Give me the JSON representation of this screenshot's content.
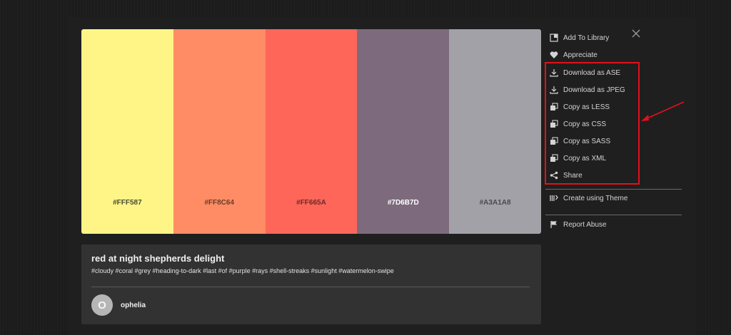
{
  "palette": {
    "swatches": [
      {
        "hex": "#FFF587",
        "label": "#FFF587",
        "text_color": "#4a4a30"
      },
      {
        "hex": "#FF8C64",
        "label": "#FF8C64",
        "text_color": "#6b3c2a"
      },
      {
        "hex": "#FF665A",
        "label": "#FF665A",
        "text_color": "#6d2a25"
      },
      {
        "hex": "#7D6B7D",
        "label": "#7D6B7D",
        "text_color": "#ffffff"
      },
      {
        "hex": "#A3A1A8",
        "label": "#A3A1A8",
        "text_color": "#4a4a4e"
      }
    ]
  },
  "theme": {
    "title": "red at night shepherds delight",
    "tags": "#cloudy #coral #grey #heading-to-dark #last #of #purple #rays #shell-streaks #sunlight #watermelon-swipe",
    "author_initial": "O",
    "author": "ophelia"
  },
  "sidebar": {
    "add_to_library": "Add To Library",
    "appreciate": "Appreciate",
    "download_ase": "Download as ASE",
    "download_jpeg": "Download as JPEG",
    "copy_less": "Copy as LESS",
    "copy_css": "Copy as CSS",
    "copy_sass": "Copy as SASS",
    "copy_xml": "Copy as XML",
    "share": "Share",
    "create_using_theme": "Create using Theme",
    "report_abuse": "Report Abuse"
  },
  "colors": {
    "highlight": "#e3101a",
    "background": "#1d1d1d",
    "card": "#323232"
  },
  "icons": [
    "close-icon",
    "library-icon",
    "heart-icon",
    "download-icon",
    "copy-icon",
    "share-icon",
    "create-icon",
    "flag-icon",
    "arrow-annotation"
  ]
}
